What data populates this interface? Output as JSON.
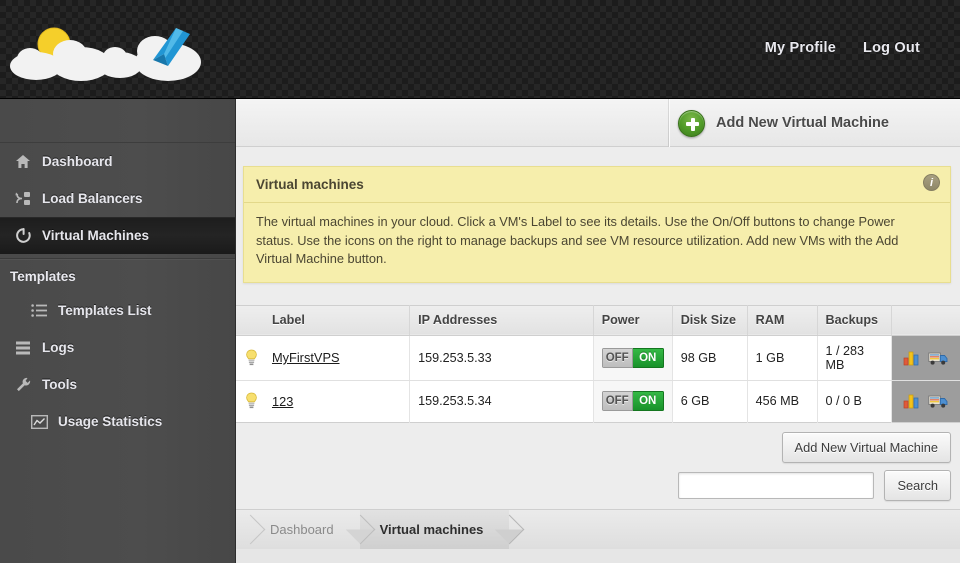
{
  "header": {
    "logo_alt": "cloud-logo",
    "nav": [
      {
        "label": "My Profile",
        "name": "my-profile-link"
      },
      {
        "label": "Log Out",
        "name": "log-out-link"
      }
    ]
  },
  "sidebar": {
    "items": [
      {
        "label": "Dashboard",
        "icon": "home-icon",
        "active": false
      },
      {
        "label": "Load Balancers",
        "icon": "load-balancer-icon",
        "active": false
      },
      {
        "label": "Virtual Machines",
        "icon": "power-cycle-icon",
        "active": true
      }
    ],
    "group_label": "Templates",
    "group_items": [
      {
        "label": "Templates List",
        "icon": "list-icon"
      }
    ],
    "lower_items": [
      {
        "label": "Logs",
        "icon": "logs-icon",
        "indent": false
      },
      {
        "label": "Tools",
        "icon": "wrench-icon",
        "indent": false
      },
      {
        "label": "Usage Statistics",
        "icon": "chart-icon",
        "indent": true
      }
    ]
  },
  "toolbar": {
    "add_vm_label": "Add New Virtual Machine",
    "plus_icon": "plus-circle-icon"
  },
  "banner": {
    "title": "Virtual machines",
    "info_icon": "info-icon",
    "info_glyph": "i",
    "body": "The virtual machines in your cloud. Click a VM's Label to see its details. Use the On/Off buttons to change Power status. Use the icons on the right to manage backups and see VM resource utilization. Add new VMs with the Add Virtual Machine button."
  },
  "table": {
    "columns": [
      "",
      "Label",
      "IP Addresses",
      "Power",
      "Disk Size",
      "RAM",
      "Backups",
      ""
    ],
    "power_labels": {
      "off": "OFF",
      "on": "ON"
    },
    "rows": [
      {
        "status_icon": "lightbulb-icon",
        "label": "MyFirstVPS",
        "ip": "159.253.5.33",
        "power": "ON",
        "disk": "98 GB",
        "ram": "1 GB",
        "backups": "1 / 283 MB",
        "actions": [
          "statistics-icon",
          "backups-truck-icon"
        ]
      },
      {
        "status_icon": "lightbulb-icon",
        "label": "123",
        "ip": "159.253.5.34",
        "power": "ON",
        "disk": "6 GB",
        "ram": "456 MB",
        "backups": "0 / 0 B",
        "actions": [
          "statistics-icon",
          "backups-truck-icon"
        ]
      }
    ]
  },
  "bottom": {
    "add_vm_button": "Add New Virtual Machine",
    "search_value": "",
    "search_placeholder": "",
    "search_button": "Search"
  },
  "breadcrumb": [
    {
      "label": "Dashboard",
      "current": false
    },
    {
      "label": "Virtual machines",
      "current": true
    }
  ],
  "colors": {
    "accent_green": "#18922a",
    "banner_yellow": "#f6eeac",
    "sidebar_dark": "#4a4a4a",
    "header_black": "#1c1c1c"
  }
}
